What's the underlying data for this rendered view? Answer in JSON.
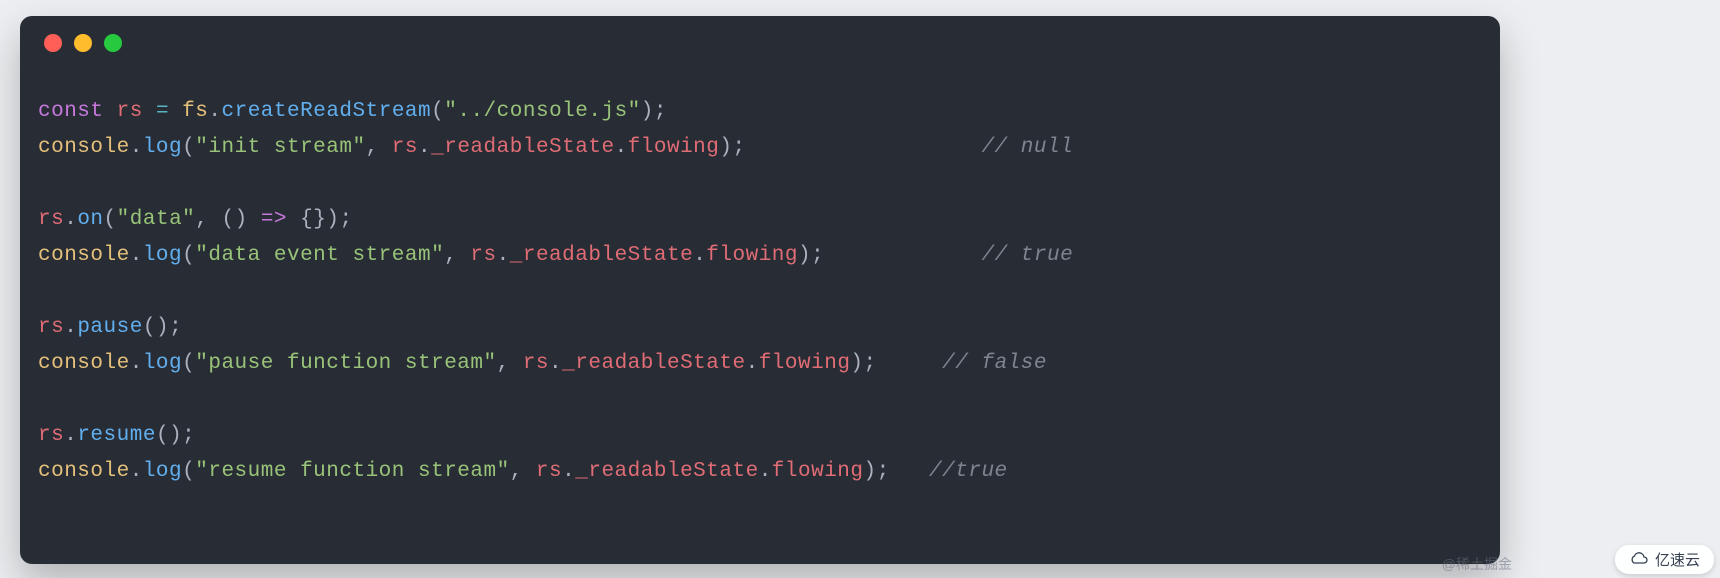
{
  "window": {
    "type": "code-editor"
  },
  "code": {
    "l1": {
      "kw": "const",
      "var": "rs",
      "eq": "=",
      "obj": "fs",
      "dot": ".",
      "fn": "createReadStream",
      "op": "(",
      "str": "\"../console.js\"",
      "cp": ")",
      "sc": ";"
    },
    "l2": {
      "obj": "console",
      "dot": ".",
      "fn": "log",
      "op": "(",
      "str": "\"init stream\"",
      "comma": ",",
      "sp": " ",
      "var": "rs",
      "dot2": ".",
      "prop1": "_readableState",
      "dot3": ".",
      "prop2": "flowing",
      "cp": ")",
      "sc": ";",
      "pad": "                  ",
      "cmnt": "// null"
    },
    "l3": "",
    "l4": {
      "var": "rs",
      "dot": ".",
      "fn": "on",
      "op": "(",
      "str": "\"data\"",
      "comma": ",",
      "sp": " ",
      "po": "(",
      "pc": ")",
      "sp2": " ",
      "arrow": "=>",
      "sp3": " ",
      "bo": "{",
      "bc": "}",
      "cp": ")",
      "sc": ";"
    },
    "l5": {
      "obj": "console",
      "dot": ".",
      "fn": "log",
      "op": "(",
      "str": "\"data event stream\"",
      "comma": ",",
      "sp": " ",
      "var": "rs",
      "dot2": ".",
      "prop1": "_readableState",
      "dot3": ".",
      "prop2": "flowing",
      "cp": ")",
      "sc": ";",
      "pad": "            ",
      "cmnt": "// true"
    },
    "l6": "",
    "l7": {
      "var": "rs",
      "dot": ".",
      "fn": "pause",
      "op": "(",
      "cp": ")",
      "sc": ";"
    },
    "l8": {
      "obj": "console",
      "dot": ".",
      "fn": "log",
      "op": "(",
      "str": "\"pause function stream\"",
      "comma": ",",
      "sp": " ",
      "var": "rs",
      "dot2": ".",
      "prop1": "_readableState",
      "dot3": ".",
      "prop2": "flowing",
      "cp": ")",
      "sc": ";",
      "pad": "     ",
      "cmnt": "// false"
    },
    "l9": "",
    "l10": {
      "var": "rs",
      "dot": ".",
      "fn": "resume",
      "op": "(",
      "cp": ")",
      "sc": ";"
    },
    "l11": {
      "obj": "console",
      "dot": ".",
      "fn": "log",
      "op": "(",
      "str": "\"resume function stream\"",
      "comma": ",",
      "sp": " ",
      "var": "rs",
      "dot2": ".",
      "prop1": "_readableState",
      "dot3": ".",
      "prop2": "flowing",
      "cp": ")",
      "sc": ";",
      "pad": "   ",
      "cmnt": "//true"
    }
  },
  "watermarks": {
    "w1": "@稀土掘金",
    "w2": "亿速云"
  }
}
